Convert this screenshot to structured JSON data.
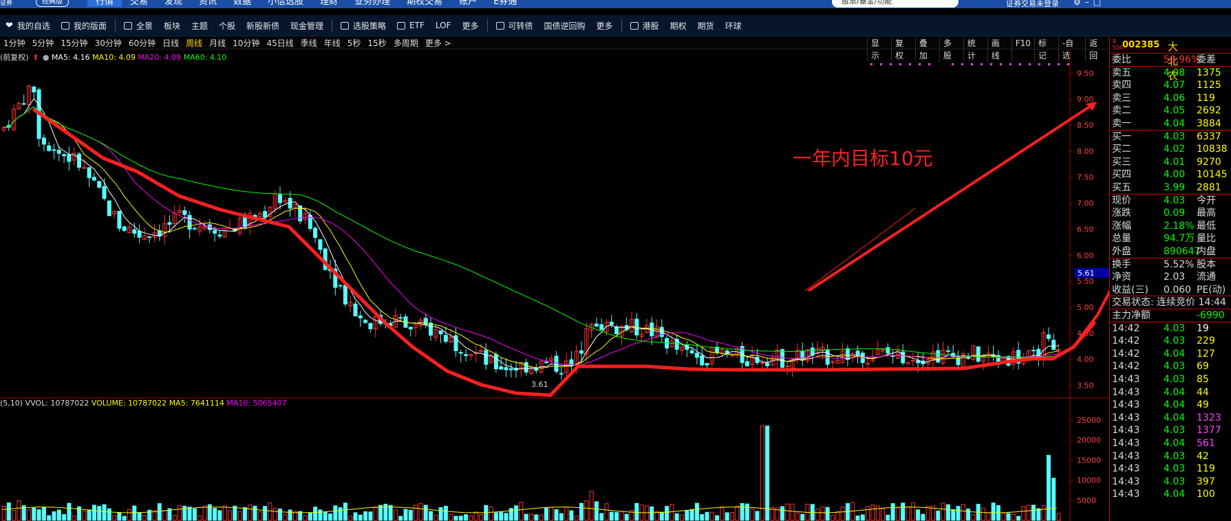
{
  "top_nav": {
    "brand": "证券",
    "edition": "经典版",
    "menu": [
      "行情",
      "交易",
      "发现",
      "资讯",
      "数据",
      "小信选股",
      "理财",
      "业务办理",
      "期权交易",
      "账户",
      "E券通"
    ],
    "active": "行情",
    "search_placeholder": "股票/基金/功能",
    "login_status": "证券交易未登录"
  },
  "toolbar": {
    "items": [
      "我的自选",
      "我的版面",
      "全景",
      "板块",
      "主题",
      "个股",
      "新股新债",
      "现金管理",
      "选股策略",
      "ETF",
      "LOF",
      "更多",
      "可转债",
      "国债逆回购",
      "更多",
      "港股",
      "期权",
      "期货",
      "环球"
    ]
  },
  "period_bar": {
    "periods": [
      "1分钟",
      "5分钟",
      "15分钟",
      "30分钟",
      "60分钟",
      "日线",
      "周线",
      "月线",
      "10分钟",
      "45日线",
      "季线",
      "年线",
      "5秒",
      "15秒",
      "多周期",
      "更多 >"
    ],
    "selected": "周线",
    "right_tools": [
      "显示",
      "复权",
      "叠加",
      "多股",
      "统计",
      "画线",
      "F10",
      "标记",
      "-自选",
      "返回"
    ]
  },
  "ma_legend": {
    "prefix": "(前复权)",
    "ma5": "MA5: 4.16",
    "ma10": "MA10: 4.09",
    "ma20": "MA20: 4.09",
    "ma60": "MA60: 4.10"
  },
  "vol_legend": {
    "prefix": "(5,10)",
    "vvol": "VVOL: 10787022",
    "volume": "VOLUME: 10787022",
    "ma5": "MA5: 7641114",
    "ma10": "MA10: 5065407"
  },
  "annotation": "一年内目标10元",
  "min_price_label": "3.61",
  "price_marker": "5.61",
  "price_axis": [
    "9.50",
    "9.00",
    "8.50",
    "8.00",
    "7.50",
    "7.00",
    "6.50",
    "6.00",
    "5.50",
    "5.00",
    "4.50",
    "4.00",
    "3.50"
  ],
  "vol_axis": [
    "25000",
    "20000",
    "15000",
    "10000",
    "5000"
  ],
  "stock": {
    "code": "002385",
    "name": "大北农",
    "rank_marker_top": "R",
    "rank_marker_bottom": "500"
  },
  "order_book": {
    "weibi_label": "委比",
    "weibi_value": "58.96%",
    "weicha_label": "委差",
    "asks": [
      {
        "label": "卖五",
        "price": "4.08",
        "vol": "1375"
      },
      {
        "label": "卖四",
        "price": "4.07",
        "vol": "1125"
      },
      {
        "label": "卖三",
        "price": "4.06",
        "vol": "119"
      },
      {
        "label": "卖二",
        "price": "4.05",
        "vol": "2692"
      },
      {
        "label": "卖一",
        "price": "4.04",
        "vol": "3884"
      }
    ],
    "bids": [
      {
        "label": "买一",
        "price": "4.03",
        "vol": "6337"
      },
      {
        "label": "买二",
        "price": "4.02",
        "vol": "10838"
      },
      {
        "label": "买三",
        "price": "4.01",
        "vol": "9270"
      },
      {
        "label": "买四",
        "price": "4.00",
        "vol": "10145"
      },
      {
        "label": "买五",
        "price": "3.99",
        "vol": "2881"
      }
    ]
  },
  "quote": [
    {
      "label": "现价",
      "value": "4.03",
      "label2": "今开"
    },
    {
      "label": "涨跌",
      "value": "0.09",
      "label2": "最高"
    },
    {
      "label": "涨幅",
      "value": "2.18%",
      "label2": "最低"
    },
    {
      "label": "总量",
      "value": "94.7万",
      "label2": "量比"
    },
    {
      "label": "外盘",
      "value": "890647",
      "label2": "内盘"
    },
    {
      "label": "换手",
      "value": "5.52%",
      "label2": "股本"
    },
    {
      "label": "净资",
      "value": "2.03",
      "label2": "流通"
    },
    {
      "label": "收益(三)",
      "value": "0.060",
      "label2": "PE(动)"
    }
  ],
  "trade_status": "交易状态: 连续竞价 14:44",
  "main_flow": {
    "label": "主力净额",
    "value": "-6990"
  },
  "ticks": [
    {
      "t": "14:42",
      "p": "4.03",
      "v": "19",
      "c": "#ffffff"
    },
    {
      "t": "14:42",
      "p": "4.03",
      "v": "229",
      "c": "#ffff00"
    },
    {
      "t": "14:42",
      "p": "4.04",
      "v": "127",
      "c": "#ffff00"
    },
    {
      "t": "14:42",
      "p": "4.03",
      "v": "69",
      "c": "#ffff00"
    },
    {
      "t": "14:43",
      "p": "4.03",
      "v": "85",
      "c": "#ffff00"
    },
    {
      "t": "14:43",
      "p": "4.04",
      "v": "44",
      "c": "#ffff00"
    },
    {
      "t": "14:43",
      "p": "4.04",
      "v": "49",
      "c": "#ffff00"
    },
    {
      "t": "14:43",
      "p": "4.04",
      "v": "1323",
      "c": "#ff44ff"
    },
    {
      "t": "14:43",
      "p": "4.03",
      "v": "1377",
      "c": "#ff44ff"
    },
    {
      "t": "14:43",
      "p": "4.04",
      "v": "561",
      "c": "#ff44ff"
    },
    {
      "t": "14:43",
      "p": "4.03",
      "v": "42",
      "c": "#ffff00"
    },
    {
      "t": "14:43",
      "p": "4.03",
      "v": "119",
      "c": "#ffff00"
    },
    {
      "t": "14:43",
      "p": "4.03",
      "v": "397",
      "c": "#ffff00"
    },
    {
      "t": "14:43",
      "p": "4.04",
      "v": "100",
      "c": "#ffff00"
    }
  ],
  "colors": {
    "up": "#ff3232",
    "down": "#54ffff",
    "ma5": "#ffffff",
    "ma10": "#ffff00",
    "ma20": "#ff00ff",
    "ma60": "#00ff00",
    "trend": "#ff2020"
  }
}
